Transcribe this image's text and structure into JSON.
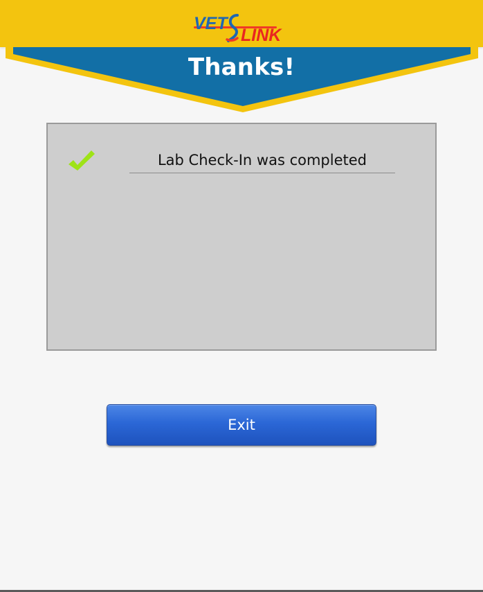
{
  "header": {
    "logo": {
      "part1": "VET",
      "part2": "LINK",
      "icon": "vetlink-logo"
    },
    "title": "Thanks!"
  },
  "main": {
    "status_icon": "check-icon",
    "message": "Lab Check-In was completed"
  },
  "actions": {
    "exit_label": "Exit"
  },
  "colors": {
    "header_yellow": "#f3c40f",
    "banner_blue": "#126fa6",
    "check_green": "#9ee317",
    "button_blue": "#2b67d6",
    "panel_gray": "#cecece"
  }
}
